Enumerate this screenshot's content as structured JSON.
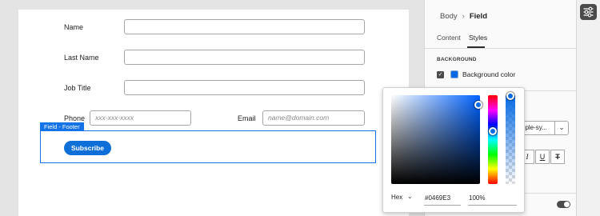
{
  "form": {
    "name_label": "Name",
    "last_name_label": "Last Name",
    "job_title_label": "Job Title",
    "phone_label": "Phone",
    "phone_placeholder": "xxx-xxx-xxxx",
    "email_label": "Email",
    "email_placeholder": "name@domain.com",
    "footer_tag": "Field - Footer",
    "subscribe_label": "Subscribe"
  },
  "panel": {
    "breadcrumb": {
      "parent": "Body",
      "current": "Field"
    },
    "tabs": [
      {
        "label": "Content",
        "active": false
      },
      {
        "label": "Styles",
        "active": true
      }
    ],
    "background_section_title": "BACKGROUND",
    "background_enabled": true,
    "background_color_label": "Background color",
    "background_color": "#0469E3",
    "font_select_value": "pple-sy...",
    "style_label_fragment": "s",
    "italic_label": "I",
    "underline_label": "U",
    "strike_label": "T",
    "toggle_on": true
  },
  "color_picker": {
    "format": "Hex",
    "hex_value": "#0469E3",
    "alpha_value": "100%"
  },
  "colors": {
    "accent": "#1473E6",
    "button": "#0E6FD8"
  }
}
